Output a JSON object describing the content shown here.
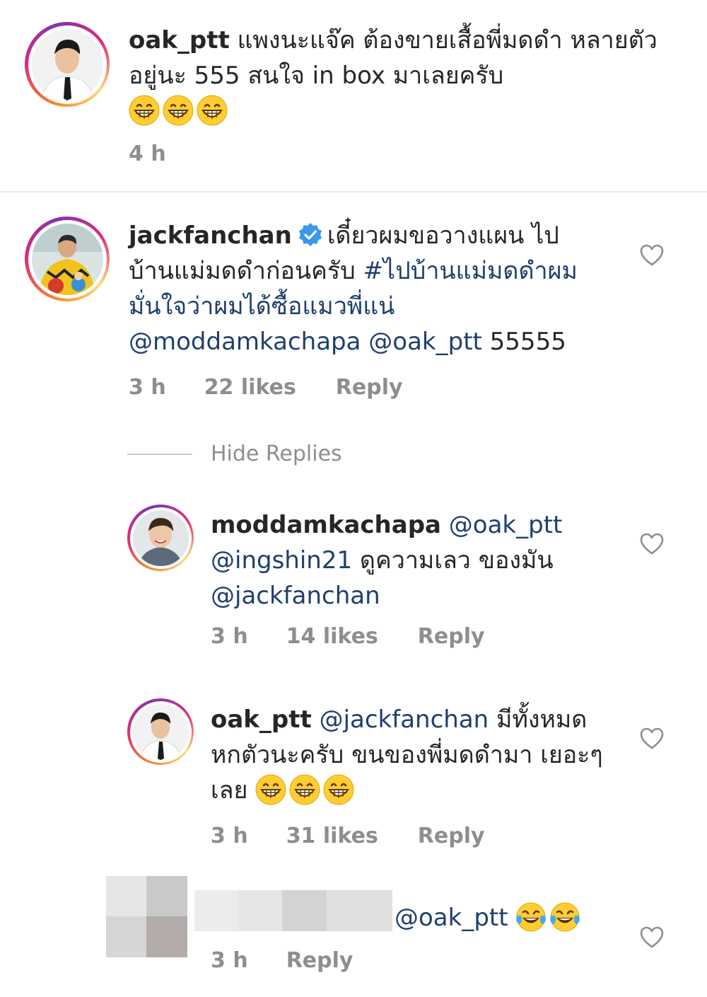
{
  "comments": [
    {
      "username": "oak_ptt",
      "text": "แพงนะแจ๊ค ต้องขายเสื้อพี่มดดำ หลายตัวอยู่นะ 555 สนใจ in box มาเลยครับ",
      "emoji": [
        "grinning-face",
        "grinning-face",
        "grinning-face"
      ],
      "time": "4 h"
    },
    {
      "username": "jackfanchan",
      "verified": true,
      "text": "เดี๋ยวผมขอวางแผน ไปบ้านแม่มดดำก่อนครับ",
      "hashtag": "#ไปบ้านแม่มดดำผมมั่นใจว่าผมได้ซื้อแมวพี่แน่",
      "mention_1": "@moddamkachapa",
      "mention_2": "@oak_ptt",
      "tail": "55555",
      "time": "3 h",
      "likes": "22 likes",
      "reply_label": "Reply",
      "hide_replies_label": "Hide Replies",
      "replies": [
        {
          "username": "moddamkachapa",
          "mention_1": "@oak_ptt",
          "mention_2": "@ingshin21",
          "text": "ดูความเลว ของมัน",
          "mention_3": "@jackfanchan",
          "time": "3 h",
          "likes": "14 likes",
          "reply_label": "Reply"
        },
        {
          "username": "oak_ptt",
          "mention_1": "@jackfanchan",
          "text": "มีทั้งหมด หกตัวนะครับ ขนของพี่มดดำมา เยอะๆเลย",
          "emoji": [
            "grinning-face",
            "grinning-face",
            "grinning-face"
          ],
          "time": "3 h",
          "likes": "31 likes",
          "reply_label": "Reply"
        },
        {
          "mention_1": "@oak_ptt",
          "emoji": [
            "tears-of-joy-face",
            "tears-of-joy-face"
          ],
          "time": "3 h",
          "reply_label": "Reply"
        }
      ]
    }
  ],
  "colors": {
    "text": "#262626",
    "meta": "#8e8e8e",
    "link": "#1f3f6e",
    "verified": "#3897f0",
    "heart": "#8e8e8e",
    "divider": "#ececec"
  }
}
